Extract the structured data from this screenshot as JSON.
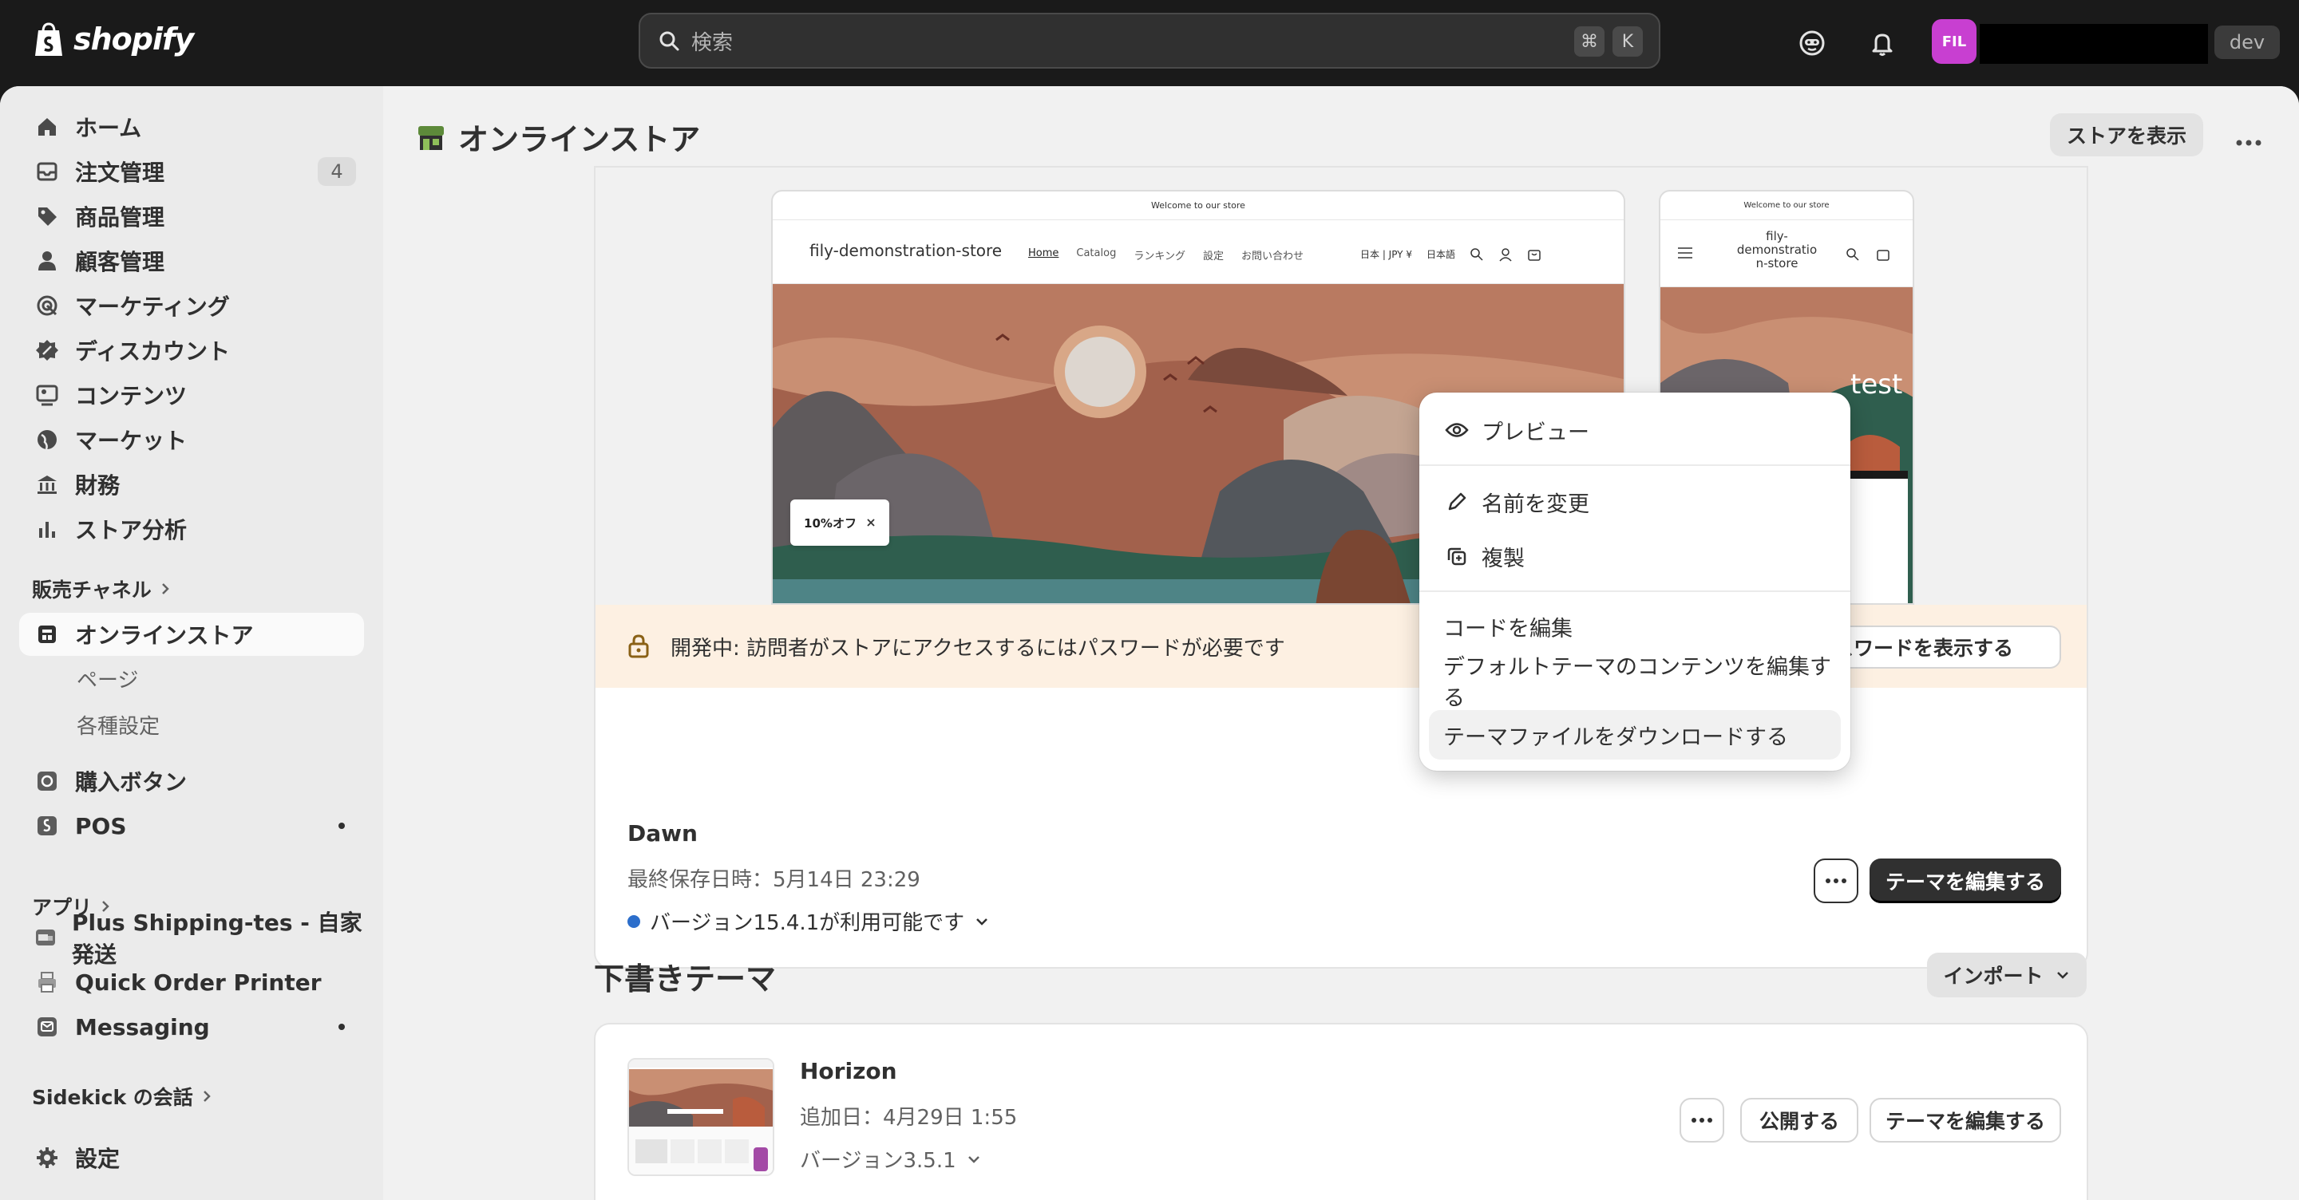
{
  "topbar": {
    "logo_text": "shopify",
    "search_placeholder": "検索",
    "shortcut_cmd": "⌘",
    "shortcut_key": "K",
    "avatar_initials": "FIL",
    "dev_badge": "dev"
  },
  "sidebar": {
    "items": [
      {
        "label": "ホーム",
        "icon": "home-icon"
      },
      {
        "label": "注文管理",
        "icon": "inbox-icon",
        "badge": "4"
      },
      {
        "label": "商品管理",
        "icon": "tag-icon"
      },
      {
        "label": "顧客管理",
        "icon": "person-icon"
      },
      {
        "label": "マーケティング",
        "icon": "target-icon"
      },
      {
        "label": "ディスカウント",
        "icon": "discount-icon"
      },
      {
        "label": "コンテンツ",
        "icon": "content-icon"
      },
      {
        "label": "マーケット",
        "icon": "globe-icon"
      },
      {
        "label": "財務",
        "icon": "bank-icon"
      },
      {
        "label": "ストア分析",
        "icon": "chart-icon"
      }
    ],
    "sales_channels_label": "販売チャネル",
    "online_store": "オンラインストア",
    "sub_pages": "ページ",
    "sub_settings": "各種設定",
    "buy_button": "購入ボタン",
    "pos": "POS",
    "apps_label": "アプリ",
    "app1": "Plus Shipping-tes - 自家発送",
    "app2": "Quick Order Printer",
    "app3": "Messaging",
    "sidekick_label": "Sidekick の会話",
    "settings": "設定"
  },
  "main": {
    "page_title": "オンラインストア",
    "view_store": "ストアを表示",
    "live_theme": {
      "announcement": "Welcome to our store",
      "store_name": "fily-demonstration-store",
      "nav": [
        "Home",
        "Catalog",
        "ランキング",
        "設定",
        "お問い合わせ"
      ],
      "currency": "日本 | JPY ¥",
      "language": "日本語",
      "mobile_store_name": "fily-demonstratio n-store",
      "mobile_hero_text": "test",
      "discount_chip": "10%オフ",
      "password_notice": "開発中: 訪問者がストアにアクセスするにはパスワードが必要です",
      "password_button": "パスワードを表示する",
      "theme_name": "Dawn",
      "last_saved": "最終保存日時：5月14日 23:29",
      "version_notice": "バージョン15.4.1が利用可能です",
      "edit_button": "テーマを編集する"
    },
    "draft_section_title": "下書きテーマ",
    "import_button": "インポート",
    "draft_theme": {
      "name": "Horizon",
      "added": "追加日：4月29日 1:55",
      "version": "バージョン3.5.1",
      "publish_button": "公開する",
      "edit_button": "テーマを編集する"
    }
  },
  "popover": {
    "preview": "プレビュー",
    "rename": "名前を変更",
    "duplicate": "複製",
    "edit_code": "コードを編集",
    "edit_default_content": "デフォルトテーマのコンテンツを編集する",
    "download_files": "テーマファイルをダウンロードする"
  },
  "colors": {
    "topbar_bg": "#1a1a1a",
    "accent_avatar": "#c83fd1",
    "primary_button": "#303030",
    "notice_bg": "#fdf0e2",
    "version_dot": "#2c6ecb"
  }
}
